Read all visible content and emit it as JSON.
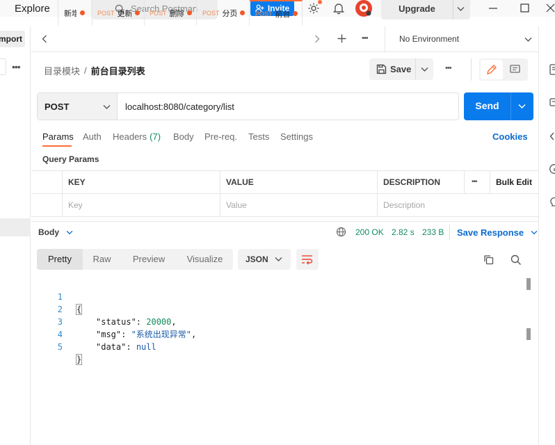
{
  "header": {
    "explore": "Explore",
    "search_placeholder": "Search Postman",
    "invite": "Invite",
    "upgrade": "Upgrade"
  },
  "sidebar": {
    "import": "mport"
  },
  "tabs": [
    {
      "method": "",
      "label": "新增"
    },
    {
      "method": "POST",
      "label": "更新"
    },
    {
      "method": "POST",
      "label": "删除"
    },
    {
      "method": "POST",
      "label": "分页"
    },
    {
      "method": "POST",
      "label": "前台"
    }
  ],
  "environment": "No Environment",
  "breadcrumb": {
    "parent": "目录模块",
    "separator": "/",
    "current": "前台目录列表"
  },
  "save": "Save",
  "request": {
    "method": "POST",
    "url": "localhost:8080/category/list",
    "send": "Send"
  },
  "request_tabs": {
    "params": "Params",
    "auth": "Auth",
    "headers": "Headers",
    "headers_count": "(7)",
    "body": "Body",
    "prereq": "Pre-req.",
    "tests": "Tests",
    "settings": "Settings",
    "cookies": "Cookies"
  },
  "query_params": {
    "title": "Query Params",
    "columns": [
      "KEY",
      "VALUE",
      "DESCRIPTION"
    ],
    "bulk_edit": "Bulk Edit",
    "placeholders": [
      "Key",
      "Value",
      "Description"
    ]
  },
  "response": {
    "body_label": "Body",
    "status": "200 OK",
    "time": "2.82 s",
    "size": "233 B",
    "save_response": "Save Response",
    "view_tabs": [
      "Pretty",
      "Raw",
      "Preview",
      "Visualize"
    ],
    "format": "JSON",
    "lines": [
      "1",
      "2",
      "3",
      "4",
      "5"
    ],
    "json": {
      "open": "{",
      "status_key": "\"status\"",
      "status_val": "20000",
      "msg_key": "\"msg\"",
      "msg_val": "\"系统出现异常\"",
      "data_key": "\"data\"",
      "data_val": "null",
      "close": "}"
    }
  },
  "colors": {
    "accent": "#ff6c37",
    "primary": "#097bed",
    "success": "#0f8c5a"
  }
}
